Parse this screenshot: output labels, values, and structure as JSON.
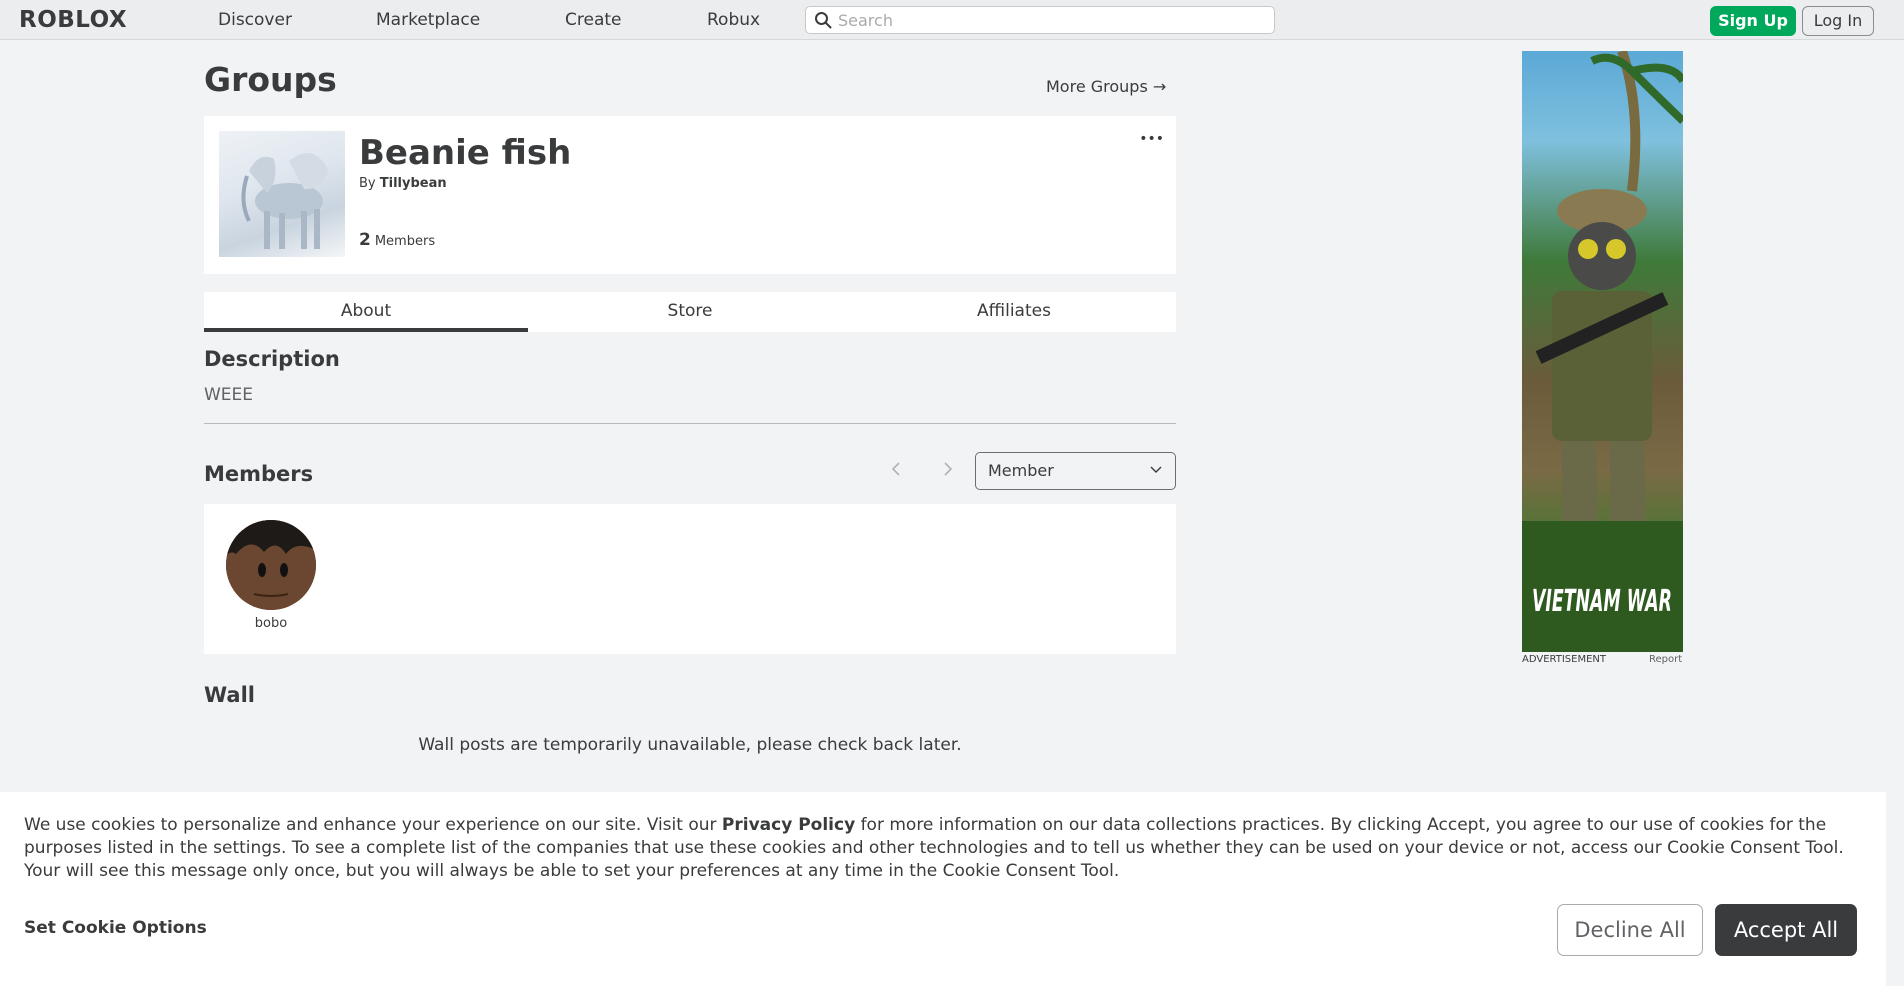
{
  "nav": {
    "logo": "ROBLOX",
    "links": [
      "Discover",
      "Marketplace",
      "Create",
      "Robux"
    ],
    "search_placeholder": "Search",
    "signup": "Sign Up",
    "login": "Log In"
  },
  "page": {
    "title": "Groups",
    "more_groups": "More Groups →"
  },
  "group": {
    "name": "Beanie fish",
    "by_prefix": "By",
    "owner": "Tillybean",
    "member_count": "2",
    "members_label": "Members",
    "menu_glyph": "•••"
  },
  "tabs": [
    "About",
    "Store",
    "Affiliates"
  ],
  "about": {
    "description_heading": "Description",
    "description_text": "WEEE",
    "members_heading": "Members",
    "role_selected": "Member",
    "members": [
      {
        "name": "bobo"
      }
    ],
    "wall_heading": "Wall",
    "wall_message": "Wall posts are temporarily unavailable, please check back later."
  },
  "ad": {
    "label": "ADVERTISEMENT",
    "report": "Report",
    "art_text": "VIETNAM WAR"
  },
  "cookie": {
    "text_before": "We use cookies to personalize and enhance your experience on our site. Visit our ",
    "privacy_link": "Privacy Policy",
    "text_after": " for more information on our data collections practices. By clicking Accept, you agree to our use of cookies for the purposes listed in the settings. To see a complete list of the companies that use these cookies and other technologies and to tell us whether they can be used on your device or not, access our Cookie Consent Tool. Your will see this message only once, but you will always be able to set your preferences at any time in the Cookie Consent Tool.",
    "set_options": "Set Cookie Options",
    "decline": "Decline All",
    "accept": "Accept All"
  },
  "colors": {
    "signup_green": "#00a85b",
    "accept_dark": "#393b3d",
    "page_bg": "#f2f3f5"
  }
}
